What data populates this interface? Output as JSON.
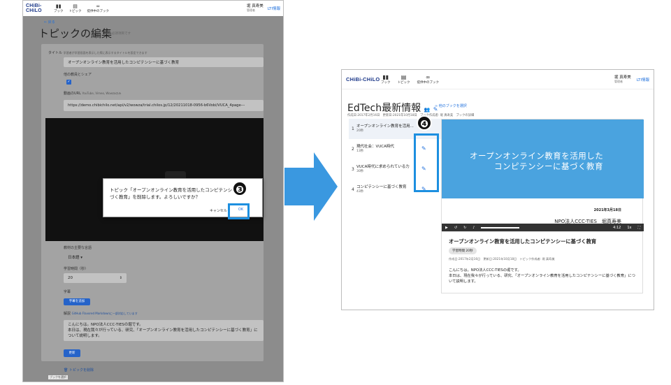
{
  "left": {
    "app": {
      "logo": "CHiBi-CHiLO",
      "nav": [
        {
          "label": "ブック",
          "icon": "book-icon"
        },
        {
          "label": "トピック",
          "icon": "topic-icon"
        },
        {
          "label": "提供中のブック",
          "icon": "link-icon"
        }
      ],
      "user_name": "堀 真寿美",
      "user_role": "管理者",
      "lti": "LTI情報"
    },
    "back": "← 戻る",
    "page_title": "トピックの編集",
    "page_note": "＊は必須項目です",
    "title_label": "タイトル",
    "title_hint": "学習者が学習画面を表示した際に表示するタイトルを設定できます",
    "title_value": "オープンオンライン教育を活用したコンピテンシーに基づく教育",
    "share_label": "他の教員とシェア",
    "video_label": "動画のURL",
    "video_hint": "YouTube, Vimeo, Wowzaのみ",
    "video_url": "https://demo.chibichilo.net/api/v2/wowza/trial.chilos.jp/12/20211018-0956-b6Vobi/VUCA_4page---",
    "dialog_message": "トピック「オープンオンライン教育を活用したコンピテンシーに基づく教育」を削除します。よろしいですか？",
    "dialog_cancel": "キャンセル",
    "dialog_ok": "OK",
    "marker_3": "❸",
    "lang_label": "教材の主要な言語",
    "lang_value": "日本語 ▾",
    "time_label": "学習時間（秒）",
    "time_value": "20",
    "caption_label": "字幕",
    "caption_button": "字幕を追加",
    "desc_label": "解説",
    "desc_hint": "GitHub Flavored Markdownに一部対応しています",
    "desc_value": "こんにちは。NPO法人CCC-TIESの堀です。\n本日は、現在我々が行っている、研究、「オープンオンライン教育を活用したコンピテンシーに基づく教育」について説明します。",
    "save_button": "更新",
    "delete_link": "トピックを削除",
    "corner_text": "ブックを選択"
  },
  "right": {
    "app": {
      "logo": "CHiBi-CHiLO",
      "nav": [
        {
          "label": "ブック",
          "icon": "book-icon"
        },
        {
          "label": "トピック",
          "icon": "topic-icon"
        },
        {
          "label": "提供中のブック",
          "icon": "link-icon"
        }
      ],
      "user_name": "堀 真寿美",
      "user_role": "管理者",
      "lti": "LTI情報"
    },
    "book_title": "EdTech最新情報",
    "other_book": "他のブックを選択",
    "book_meta": "作成日:2017年2月16日　更新日:2021年10月18日　ブック作成者: 堀 真寿美　ブックの詳細",
    "marker_4": "❹",
    "topics": [
      {
        "num": "1",
        "title": "オープンオンライン教育を活用...",
        "duration": "20秒"
      },
      {
        "num": "2",
        "title": "現代社会：VUCA時代",
        "duration": "13秒"
      },
      {
        "num": "3",
        "title": "VUCA時代に求められている力",
        "duration": "30秒"
      },
      {
        "num": "4",
        "title": "コンピテンシーに基づく教育",
        "duration": "43秒"
      }
    ],
    "slide_line1": "オープンオンライン教育を活用した",
    "slide_line2": "コンピテンシーに基づく教育",
    "slide_date": "2021年3月18日",
    "slide_org": "NPO法人CCC-TIES　堀真寿美",
    "player_time": "4:12",
    "player_speed": "1x",
    "topic_heading": "オープンオンライン教育を活用したコンピテンシーに基づく教育",
    "chip": "学習時間 20秒",
    "topic_meta": "作成日:2017年2月16日　更新日:2021年10月18日　トピック作成者: 堀 真寿美",
    "desc_line1": "こんにちは。NPO法人CCC-TIESの堀です。",
    "desc_line2": "本日は、現在我々が行っている、研究、「オープンオンライン教育を活用したコンピテンシーに基づく教育」について説明します。"
  },
  "colors": {
    "accent": "#1d8fe0",
    "arrow": "#3a98e0",
    "slide": "#4aa3df"
  }
}
